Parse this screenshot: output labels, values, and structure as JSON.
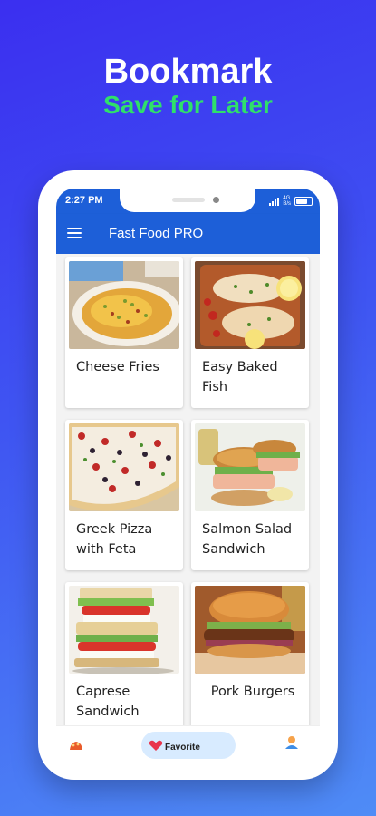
{
  "promo": {
    "title": "Bookmark",
    "subtitle": "Save for Later"
  },
  "status_bar": {
    "time": "2:27 PM",
    "network_top": "4G",
    "network_bottom": "B/s"
  },
  "app_bar": {
    "title": "Fast Food PRO",
    "menu_icon": "hamburger-menu-icon"
  },
  "recipes": [
    {
      "title": "Cheese Fries",
      "icon": "cheese-fries-photo"
    },
    {
      "title": "Easy Baked Fish",
      "icon": "baked-fish-photo"
    },
    {
      "title": "Greek Pizza with Feta",
      "icon": "greek-pizza-photo"
    },
    {
      "title": "Salmon Salad Sandwich",
      "icon": "salmon-sandwich-photo"
    },
    {
      "title": "Caprese Sandwich",
      "icon": "caprese-sandwich-photo"
    },
    {
      "title": "Pork Burgers",
      "icon": "pork-burger-photo"
    }
  ],
  "bottom_nav": {
    "favorite_label": "Favorite",
    "items": [
      "home-icon",
      "heart-icon",
      "profile-icon"
    ]
  },
  "colors": {
    "app_blue": "#1d5fd8",
    "subtitle_green": "#2fe06a",
    "favorite_pill": "#d8ebff"
  }
}
